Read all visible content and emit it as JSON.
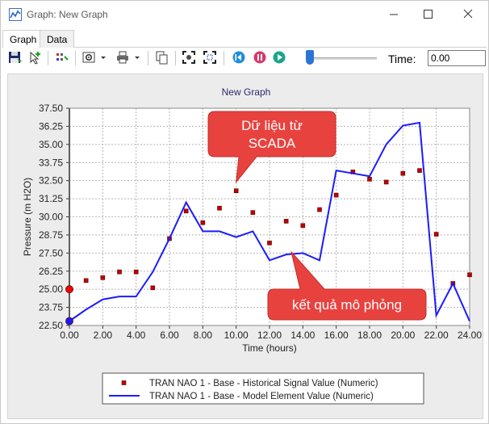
{
  "window": {
    "title": "Graph: New Graph"
  },
  "tabs": [
    {
      "label": "Graph"
    },
    {
      "label": "Data"
    }
  ],
  "toolbar": {
    "time_label": "Time:",
    "time_value": "0.00",
    "slider_fraction": 0
  },
  "chart_data": {
    "type": "line",
    "title": "New Graph",
    "xlabel": "Time (hours)",
    "ylabel": "Pressure (m H2O)",
    "xlim": [
      0,
      24
    ],
    "ylim": [
      22.5,
      37.5
    ],
    "xticks": [
      "0.00",
      "2.00",
      "4.00",
      "6.00",
      "8.00",
      "10.00",
      "12.00",
      "14.00",
      "16.00",
      "18.00",
      "20.00",
      "22.00",
      "24.00"
    ],
    "yticks": [
      "22.50",
      "23.75",
      "25.00",
      "26.25",
      "27.50",
      "28.75",
      "30.00",
      "31.25",
      "32.50",
      "33.75",
      "35.00",
      "36.25",
      "37.50"
    ],
    "grid": true,
    "legend_placement": "bottom",
    "series": [
      {
        "name": "TRAN NAO 1 - Base - Historical Signal Value (Numeric)",
        "kind": "scatter",
        "color": "#c00000",
        "x": [
          0,
          1,
          2,
          3,
          4,
          5,
          6,
          7,
          8,
          9,
          10,
          11,
          12,
          13,
          14,
          15,
          16,
          17,
          18,
          19,
          20,
          21,
          22,
          23,
          24
        ],
        "y": [
          25.0,
          25.6,
          25.8,
          26.2,
          26.2,
          25.1,
          28.5,
          30.4,
          29.6,
          30.6,
          31.8,
          30.3,
          28.2,
          29.7,
          29.4,
          30.5,
          31.5,
          33.1,
          32.6,
          32.4,
          33.0,
          33.2,
          28.8,
          25.4,
          26.0
        ]
      },
      {
        "name": "TRAN NAO 1 - Base - Model Element Value (Numeric)",
        "kind": "line",
        "color": "#1b1bff",
        "x": [
          0,
          1,
          2,
          3,
          4,
          5,
          6,
          7,
          8,
          9,
          10,
          11,
          12,
          13,
          14,
          15,
          16,
          17,
          18,
          19,
          20,
          21,
          22,
          23,
          24
        ],
        "y": [
          22.8,
          23.6,
          24.3,
          24.5,
          24.5,
          26.2,
          28.5,
          31.0,
          29.0,
          29.0,
          28.6,
          29.0,
          27.0,
          27.4,
          27.5,
          27.0,
          33.2,
          33.0,
          32.8,
          35.0,
          36.3,
          36.5,
          23.2,
          25.4,
          22.8
        ]
      }
    ],
    "start_markers": [
      {
        "series_index": 0,
        "x": 0,
        "y": 25.0,
        "color": "#ff0000"
      },
      {
        "series_index": 1,
        "x": 0,
        "y": 22.8,
        "color": "#1b1bff"
      }
    ],
    "annotations": [
      {
        "text_lines": [
          "Dữ liệu từ",
          "SCADA"
        ],
        "pointer_x": 10,
        "pointer_y": 32.4,
        "color": "#e8423f"
      },
      {
        "text_lines": [
          "kết quả mô phỏng"
        ],
        "pointer_x": 13.3,
        "pointer_y": 27.6,
        "color": "#e8423f"
      }
    ]
  }
}
